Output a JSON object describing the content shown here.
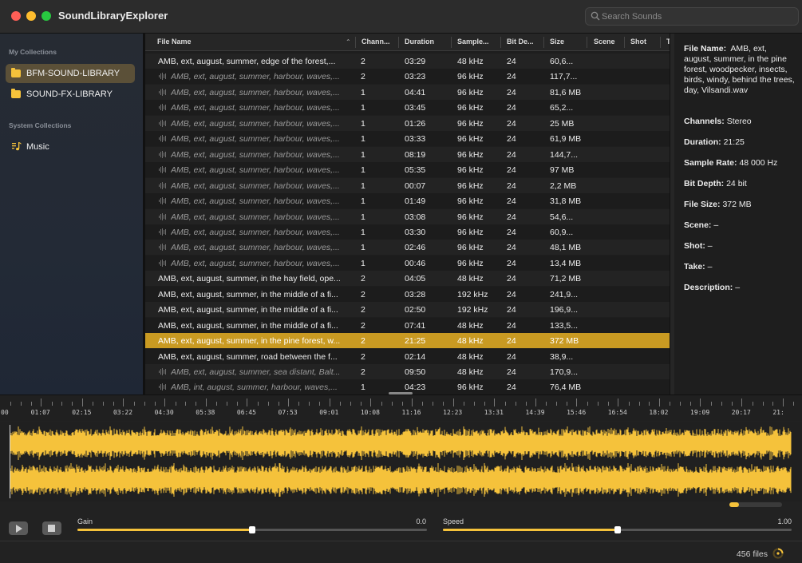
{
  "app": {
    "title": "SoundLibraryExplorer"
  },
  "search": {
    "placeholder": "Search Sounds"
  },
  "sidebar": {
    "my_collections_title": "My Collections",
    "collections": [
      {
        "label": "BFM-SOUND-LIBRARY",
        "selected": true,
        "icon": "folder-icon"
      },
      {
        "label": "SOUND-FX-LIBRARY",
        "selected": false,
        "icon": "folder-icon"
      }
    ],
    "system_collections_title": "System Collections",
    "system": [
      {
        "label": "Music",
        "icon": "music-note-icon"
      }
    ]
  },
  "table": {
    "columns": [
      "File Name",
      "Chann...",
      "Duration",
      "Sample...",
      "Bit De...",
      "Size",
      "Scene",
      "Shot",
      "T"
    ],
    "sorted_column": "File Name",
    "rows": [
      {
        "name": "AMB, ext, august, summer, edge of the forest,...",
        "ch": "2",
        "dur": "03:29",
        "sr": "48 kHz",
        "bd": "24",
        "size": "60,6...",
        "italic": false
      },
      {
        "name": "AMB, ext, august, summer, harbour, waves,...",
        "ch": "2",
        "dur": "03:23",
        "sr": "96 kHz",
        "bd": "24",
        "size": "117,7...",
        "italic": true
      },
      {
        "name": "AMB, ext, august, summer, harbour, waves,...",
        "ch": "1",
        "dur": "04:41",
        "sr": "96 kHz",
        "bd": "24",
        "size": "81,6 MB",
        "italic": true
      },
      {
        "name": "AMB, ext, august, summer, harbour, waves,...",
        "ch": "1",
        "dur": "03:45",
        "sr": "96 kHz",
        "bd": "24",
        "size": "65,2...",
        "italic": true
      },
      {
        "name": "AMB, ext, august, summer, harbour, waves,...",
        "ch": "1",
        "dur": "01:26",
        "sr": "96 kHz",
        "bd": "24",
        "size": "25 MB",
        "italic": true
      },
      {
        "name": "AMB, ext, august, summer, harbour, waves,...",
        "ch": "1",
        "dur": "03:33",
        "sr": "96 kHz",
        "bd": "24",
        "size": "61,9 MB",
        "italic": true
      },
      {
        "name": "AMB, ext, august, summer, harbour, waves,...",
        "ch": "1",
        "dur": "08:19",
        "sr": "96 kHz",
        "bd": "24",
        "size": "144,7...",
        "italic": true
      },
      {
        "name": "AMB, ext, august, summer, harbour, waves,...",
        "ch": "1",
        "dur": "05:35",
        "sr": "96 kHz",
        "bd": "24",
        "size": "97 MB",
        "italic": true
      },
      {
        "name": "AMB, ext, august, summer, harbour, waves,...",
        "ch": "1",
        "dur": "00:07",
        "sr": "96 kHz",
        "bd": "24",
        "size": "2,2 MB",
        "italic": true
      },
      {
        "name": "AMB, ext, august, summer, harbour, waves,...",
        "ch": "1",
        "dur": "01:49",
        "sr": "96 kHz",
        "bd": "24",
        "size": "31,8 MB",
        "italic": true
      },
      {
        "name": "AMB, ext, august, summer, harbour, waves,...",
        "ch": "1",
        "dur": "03:08",
        "sr": "96 kHz",
        "bd": "24",
        "size": "54,6...",
        "italic": true
      },
      {
        "name": "AMB, ext, august, summer, harbour, waves,...",
        "ch": "1",
        "dur": "03:30",
        "sr": "96 kHz",
        "bd": "24",
        "size": "60,9...",
        "italic": true
      },
      {
        "name": "AMB, ext, august, summer, harbour, waves,...",
        "ch": "1",
        "dur": "02:46",
        "sr": "96 kHz",
        "bd": "24",
        "size": "48,1 MB",
        "italic": true
      },
      {
        "name": "AMB, ext, august, summer, harbour, waves,...",
        "ch": "1",
        "dur": "00:46",
        "sr": "96 kHz",
        "bd": "24",
        "size": "13,4 MB",
        "italic": true
      },
      {
        "name": "AMB, ext, august, summer, in the hay field, ope...",
        "ch": "2",
        "dur": "04:05",
        "sr": "48 kHz",
        "bd": "24",
        "size": "71,2 MB",
        "italic": false
      },
      {
        "name": "AMB, ext, august, summer, in the middle of a fi...",
        "ch": "2",
        "dur": "03:28",
        "sr": "192 kHz",
        "bd": "24",
        "size": "241,9...",
        "italic": false
      },
      {
        "name": "AMB, ext, august, summer, in the middle of a fi...",
        "ch": "2",
        "dur": "02:50",
        "sr": "192 kHz",
        "bd": "24",
        "size": "196,9...",
        "italic": false
      },
      {
        "name": "AMB, ext, august, summer, in the middle of a fi...",
        "ch": "2",
        "dur": "07:41",
        "sr": "48 kHz",
        "bd": "24",
        "size": "133,5...",
        "italic": false
      },
      {
        "name": "AMB, ext, august, summer, in the pine forest, w...",
        "ch": "2",
        "dur": "21:25",
        "sr": "48 kHz",
        "bd": "24",
        "size": "372 MB",
        "italic": false,
        "selected": true
      },
      {
        "name": "AMB, ext, august, summer, road between the f...",
        "ch": "2",
        "dur": "02:14",
        "sr": "48 kHz",
        "bd": "24",
        "size": "38,9...",
        "italic": false
      },
      {
        "name": "AMB, ext, august, summer, sea distant, Balt...",
        "ch": "2",
        "dur": "09:50",
        "sr": "48 kHz",
        "bd": "24",
        "size": "170,9...",
        "italic": true
      },
      {
        "name": "AMB, int, august, summer, harbour, waves,...",
        "ch": "1",
        "dur": "04:23",
        "sr": "96 kHz",
        "bd": "24",
        "size": "76,4 MB",
        "italic": true
      }
    ]
  },
  "details": {
    "file_name_label": "File Name:",
    "file_name_value": "AMB, ext, august, summer, in the pine forest, woodpecker, insects, birds, windy, behind the trees, day, Vilsandi.wav",
    "channels_label": "Channels:",
    "channels_value": "Stereo",
    "duration_label": "Duration:",
    "duration_value": "21:25",
    "sample_rate_label": "Sample Rate:",
    "sample_rate_value": "48 000 Hz",
    "bit_depth_label": "Bit Depth:",
    "bit_depth_value": "24 bit",
    "file_size_label": "File Size:",
    "file_size_value": "372 MB",
    "scene_label": "Scene:",
    "scene_value": "–",
    "shot_label": "Shot:",
    "shot_value": "–",
    "take_label": "Take:",
    "take_value": "–",
    "description_label": "Description:",
    "description_value": "–"
  },
  "timeline": {
    "labels": [
      "00",
      "01:07",
      "02:15",
      "03:22",
      "04:30",
      "05:38",
      "06:45",
      "07:53",
      "09:01",
      "10:08",
      "11:16",
      "12:23",
      "13:31",
      "14:39",
      "15:46",
      "16:54",
      "18:02",
      "19:09",
      "20:17",
      "21:"
    ]
  },
  "colors": {
    "accent": "#f5c23b",
    "selection": "#c99a22",
    "waveform": "#f5c23b"
  },
  "controls": {
    "gain_label": "Gain",
    "gain_value": "0.0",
    "gain_level": 0.5,
    "speed_label": "Speed",
    "speed_value": "1.00",
    "speed_level": 0.5
  },
  "status": {
    "file_count": "456 files"
  }
}
